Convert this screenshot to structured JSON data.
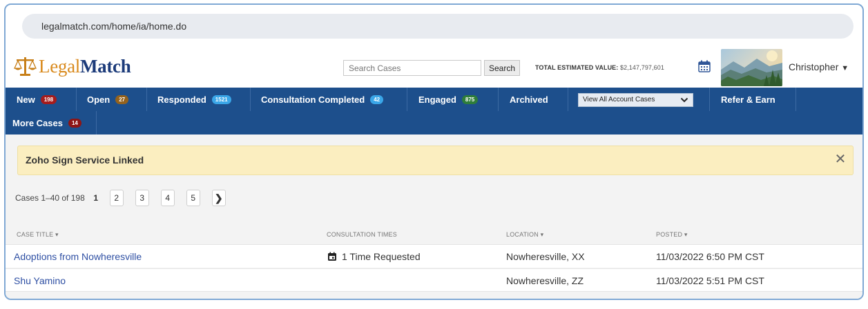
{
  "browser": {
    "url": "legalmatch.com/home/ia/home.do"
  },
  "header": {
    "logo": {
      "part1": "Legal",
      "part2": "Match"
    },
    "search": {
      "placeholder": "Search Cases",
      "button_label": "Search"
    },
    "total_estimated_value": {
      "label": "TOTAL ESTIMATED VALUE:",
      "value": "$2,147,797,601"
    },
    "user": {
      "name": "Christopher",
      "menu_caret": "▼"
    }
  },
  "nav": {
    "items": [
      {
        "label": "New",
        "badge": "198"
      },
      {
        "label": "Open",
        "badge": "27"
      },
      {
        "label": "Responded",
        "badge": "1521"
      },
      {
        "label": "Consultation Completed",
        "badge": "42"
      },
      {
        "label": "Engaged",
        "badge": "875"
      },
      {
        "label": "Archived"
      },
      {
        "label": "Refer & Earn"
      },
      {
        "label": "More Cases",
        "badge": "14"
      }
    ],
    "account_select": {
      "value": "View All Account Cases"
    }
  },
  "alert": {
    "text": "Zoho Sign Service Linked",
    "close": "✕"
  },
  "pagination": {
    "label": "Cases 1–40 of 198",
    "pages": [
      "1",
      "2",
      "3",
      "4",
      "5"
    ],
    "current": "1",
    "next": "❯"
  },
  "table": {
    "columns": [
      "CASE TITLE ▾",
      "CONSULTATION TIMES",
      "LOCATION ▾",
      "POSTED ▾"
    ],
    "rows": [
      {
        "title": "Adoptions from Nowheresville",
        "consultation": "1 Time Requested",
        "location": "Nowheresville, XX",
        "posted": "11/03/2022 6:50 PM CST"
      },
      {
        "title": "Shu Yamino",
        "consultation": "",
        "location": "Nowheresville, ZZ",
        "posted": "11/03/2022 5:51 PM CST"
      }
    ]
  },
  "colors": {
    "nav_bg": "#1d4f8c",
    "logo_gold": "#d98a1d",
    "logo_navy": "#1c3b7a",
    "alert_bg": "#fbeec0",
    "link": "#2e4fa3"
  },
  "icons": [
    "scales-logo-icon",
    "calendar-icon",
    "chevron-down-icon",
    "close-icon",
    "chevron-right-icon",
    "calendar-small-icon"
  ]
}
